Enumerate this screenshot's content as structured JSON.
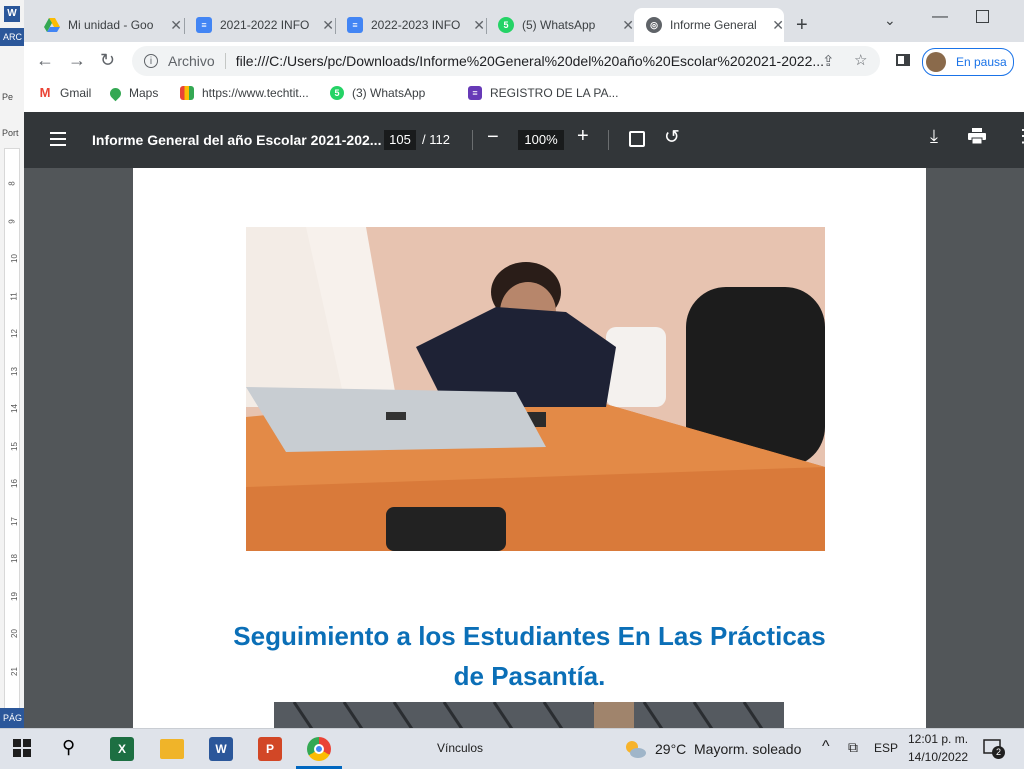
{
  "word_window": {
    "icon_letter": "W",
    "ribbon_label": "ARC",
    "side_text_1": "Pe",
    "side_text_2": "Port",
    "ruler_numbers": [
      "8",
      "9",
      "10",
      "11",
      "12",
      "13",
      "14",
      "15",
      "16",
      "17",
      "18",
      "19",
      "20",
      "21"
    ],
    "status_label": "PÁG"
  },
  "browser": {
    "tabs": [
      {
        "label": "Mi unidad - Goo",
        "icon": "google-drive-icon",
        "active": false
      },
      {
        "label": "2021-2022 INFO",
        "icon": "google-docs-icon",
        "active": false
      },
      {
        "label": "2022-2023 INFO",
        "icon": "google-docs-icon",
        "active": false
      },
      {
        "label": "(5) WhatsApp",
        "icon": "whatsapp-icon",
        "active": false
      },
      {
        "label": "Informe General",
        "icon": "globe-icon",
        "active": true
      }
    ],
    "address_scheme": "Archivo",
    "url": "file:///C:/Users/pc/Downloads/Informe%20General%20del%20año%20Escolar%202021-2022...",
    "profile_label": "En pausa",
    "bookmarks": [
      {
        "label": "Gmail",
        "icon": "gmail-icon"
      },
      {
        "label": "Maps",
        "icon": "maps-icon"
      },
      {
        "label": "https://www.techtit...",
        "icon": "grid-icon"
      },
      {
        "label": "(3) WhatsApp",
        "icon": "whatsapp-icon"
      },
      {
        "label": "REGISTRO DE LA PA...",
        "icon": "forms-icon"
      }
    ]
  },
  "pdf": {
    "title": "Informe General del año Escolar 2021-202...",
    "page_current": "105",
    "page_total": "/ 112",
    "zoom": "100%",
    "heading_line1": "Seguimiento a los Estudiantes En Las Prácticas",
    "heading_line2": "de Pasantía."
  },
  "taskbar": {
    "links_label": "Vínculos",
    "temperature": "29°C",
    "weather": "Mayorm. soleado",
    "language": "ESP",
    "time": "12:01 p. m.",
    "date": "14/10/2022",
    "notification_count": "2"
  },
  "colors": {
    "heading_blue": "#0b6fb7",
    "pdf_toolbar": "#323639",
    "viewer_bg": "#525659"
  }
}
